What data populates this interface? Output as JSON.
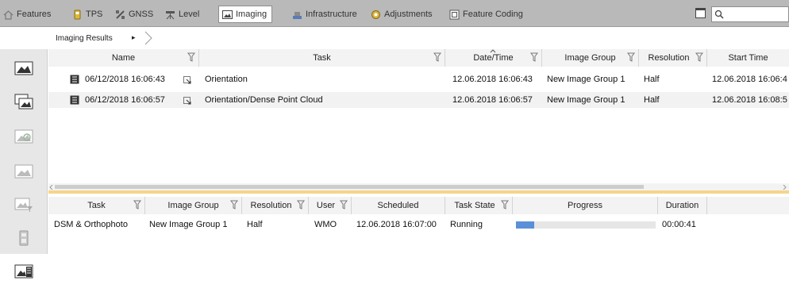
{
  "tabs": [
    {
      "label": "Features",
      "icon": "house-icon"
    },
    {
      "label": "TPS",
      "icon": "tps-instrument-icon"
    },
    {
      "label": "GNSS",
      "icon": "satellite-icon"
    },
    {
      "label": "Level",
      "icon": "level-instrument-icon"
    },
    {
      "label": "Imaging",
      "icon": "image-icon",
      "active": true
    },
    {
      "label": "Infrastructure",
      "icon": "infrastructure-icon"
    },
    {
      "label": "Adjustments",
      "icon": "adjustments-gear-icon"
    },
    {
      "label": "Feature Coding",
      "icon": "feature-coding-icon"
    }
  ],
  "search": {
    "placeholder": ""
  },
  "breadcrumb": {
    "label": "Imaging Results",
    "sep": "▸"
  },
  "results": {
    "columns": [
      "Name",
      "Task",
      "Date/Time",
      "Image Group",
      "Resolution",
      "Start Time"
    ],
    "rows": [
      {
        "name": "06/12/2018 16:06:43",
        "task": "Orientation",
        "datetime": "12.06.2018 16:06:43",
        "group": "New Image Group 1",
        "resolution": "Half",
        "start": "12.06.2018 16:06:4"
      },
      {
        "name": "06/12/2018 16:06:57",
        "task": "Orientation/Dense Point Cloud",
        "datetime": "12.06.2018 16:06:57",
        "group": "New Image Group 1",
        "resolution": "Half",
        "start": "12.06.2018 16:08:5"
      }
    ]
  },
  "tasks": {
    "columns": [
      "Task",
      "Image Group",
      "Resolution",
      "User",
      "Scheduled",
      "Task State",
      "Progress",
      "Duration"
    ],
    "rows": [
      {
        "task": "DSM & Orthophoto",
        "group": "New Image Group 1",
        "resolution": "Half",
        "user": "WMO",
        "scheduled": "12.06.2018 16:07:00",
        "state": "Running",
        "progress": 0.13,
        "duration": "00:00:41"
      }
    ]
  },
  "colors": {
    "tabbar": "#b9b9b9",
    "progress": "#5b8fd8",
    "splitter": "#f4d58a"
  }
}
